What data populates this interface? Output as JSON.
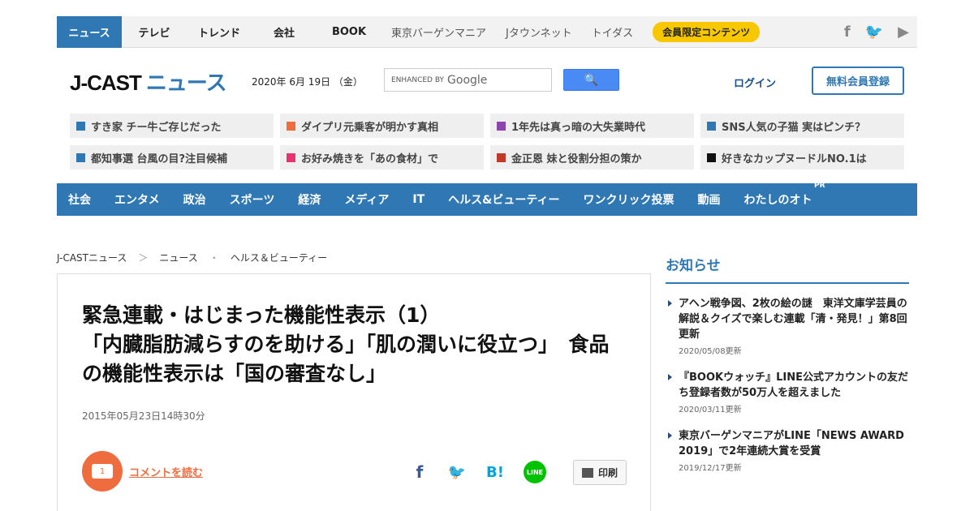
{
  "topbar": {
    "tabs": [
      "ニュース",
      "テレビ",
      "トレンド",
      "会社",
      "BOOK"
    ],
    "external": [
      "東京バーゲンマニア",
      "Jタウンネット",
      "トイダス"
    ],
    "member_label": "会員限定コンテンツ",
    "social": [
      "f",
      "🐦",
      "▶"
    ]
  },
  "header": {
    "logo_j": "J-CAST",
    "logo_news": "ニュース",
    "date": "2020年 6月 19日 （金）",
    "search_prefix": "ENHANCED BY",
    "search_brand": "Google",
    "search_button": "🔍",
    "login": "ログイン",
    "signup": "無料会員登録"
  },
  "headlines": [
    {
      "text": "すき家 チー牛ご存じだった",
      "color": "#2f78b4"
    },
    {
      "text": "ダイプリ元乗客が明かす真相",
      "color": "#ef6c3f"
    },
    {
      "text": "1年先は真っ暗の大失業時代",
      "color": "#8e44ad"
    },
    {
      "text": "SNS人気の子猫 実はピンチ？",
      "color": "#2f78b4"
    },
    {
      "text": "都知事選 台風の目?注目候補",
      "color": "#2f78b4"
    },
    {
      "text": "お好み焼きを「あの食材」で",
      "color": "#e8336e"
    },
    {
      "text": "金正恩 妹と役割分担の策か",
      "color": "#c0392b"
    },
    {
      "text": "好きなカップヌードルNO.1は",
      "color": "#111111"
    }
  ],
  "nav": {
    "items": [
      "社会",
      "エンタメ",
      "政治",
      "スポーツ",
      "経済",
      "メディア",
      "IT",
      "ヘルス&ビューティー",
      "ワンクリック投票",
      "動画",
      "わたしのオト"
    ],
    "pr": "PR"
  },
  "breadcrumb": [
    "J-CASTニュース",
    "＞",
    "ニュース",
    "・",
    "ヘルス＆ビューティー"
  ],
  "article": {
    "title": "緊急連載・はじまった機能性表示（1）\n「内臓脂肪減らすのを助ける」「肌の潤いに役立つ」　食品の機能性表示は「国の審査なし」",
    "date": "2015年05月23日14時30分",
    "comment_count": "1",
    "comment_link": "コメントを読む",
    "share": {
      "fb": "f",
      "tw": "🐦",
      "hb": "B!",
      "line": "LINE"
    },
    "print": "印刷"
  },
  "sidebar": {
    "heading": "お知らせ",
    "items": [
      {
        "title": "アヘン戦争図、2枚の絵の謎　東洋文庫学芸員の解説＆クイズで楽しむ連載「清・発見！」第8回更新",
        "date": "2020/05/08更新"
      },
      {
        "title": "『BOOKウォッチ』LINE公式アカウントの友だち登録者数が50万人を超えました",
        "date": "2020/03/11更新"
      },
      {
        "title": "東京バーゲンマニアがLINE「NEWS AWARD 2019」で2年連続大賞を受賞",
        "date": "2019/12/17更新"
      }
    ]
  }
}
